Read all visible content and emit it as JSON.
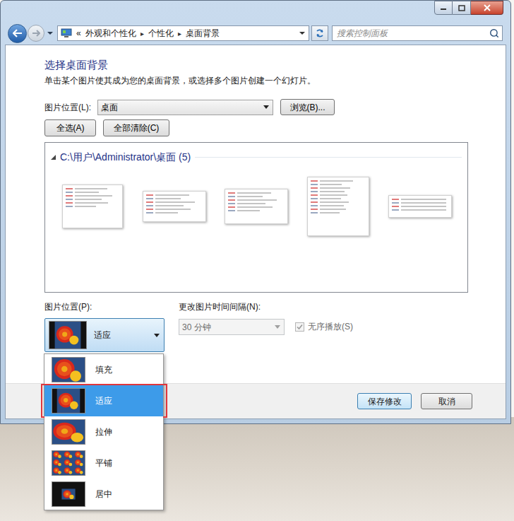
{
  "address_bar": {
    "overflow": "«",
    "separator": "▸",
    "breadcrumb": [
      "外观和个性化",
      "个性化",
      "桌面背景"
    ],
    "search_placeholder": "搜索控制面板"
  },
  "heading": "选择桌面背景",
  "description": "单击某个图片使其成为您的桌面背景，或选择多个图片创建一个幻灯片。",
  "picture_location": {
    "label": "图片位置(L):",
    "value": "桌面",
    "browse": "浏览(B)..."
  },
  "select_buttons": [
    "全选(A)",
    "全部清除(C)"
  ],
  "gallery": {
    "group": "C:\\用户\\Administrator\\桌面 (5)",
    "expanded": true,
    "images": [
      {
        "kind": "page"
      },
      {
        "kind": "snippet"
      },
      {
        "kind": "form"
      },
      {
        "kind": "list"
      },
      {
        "kind": "table"
      }
    ]
  },
  "position": {
    "label": "图片位置(P):",
    "value": "适应",
    "value_kind": "fit",
    "open": true,
    "options": [
      {
        "label": "填充",
        "kind": "fill",
        "selected": false
      },
      {
        "label": "适应",
        "kind": "fit",
        "selected": true
      },
      {
        "label": "拉伸",
        "kind": "stretch",
        "selected": false
      },
      {
        "label": "平铺",
        "kind": "tile",
        "selected": false
      },
      {
        "label": "居中",
        "kind": "center",
        "selected": false
      }
    ]
  },
  "interval": {
    "label": "更改图片时间间隔(N):",
    "value": "30 分钟",
    "disabled": true
  },
  "shuffle": {
    "label": "无序播放(S)",
    "checked": true,
    "disabled": true
  },
  "buttons": [
    {
      "label": "保存修改",
      "default": true
    },
    {
      "label": "取消",
      "default": false
    }
  ]
}
